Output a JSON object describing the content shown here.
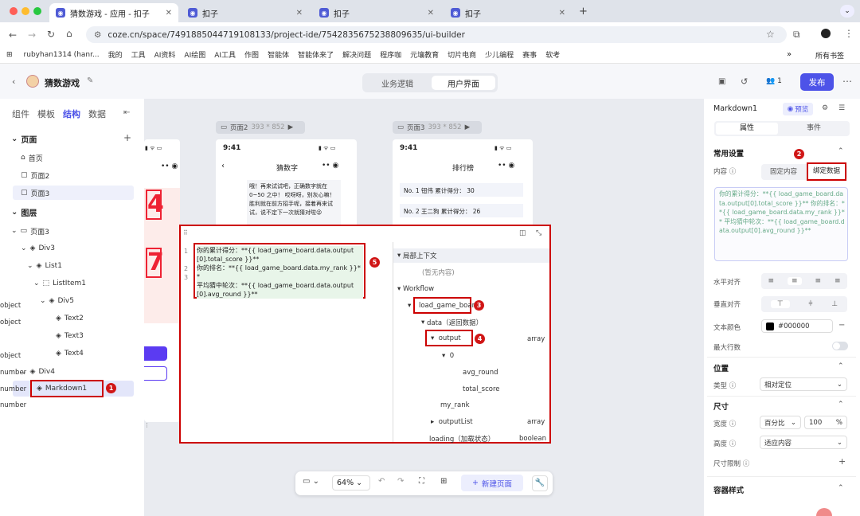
{
  "browser": {
    "tabs": [
      {
        "title": "猜数游戏 - 应用 - 扣子",
        "active": true
      },
      {
        "title": "扣子",
        "active": false
      },
      {
        "title": "扣子",
        "active": false
      },
      {
        "title": "扣子",
        "active": false
      }
    ],
    "url": "coze.cn/space/7491885044719108133/project-ide/7542835675238809635/ui-builder",
    "bookmarks": [
      "rubyhan1314 (hanr...",
      "我的",
      "工具",
      "AI资料",
      "AI绘图",
      "AI工具",
      "作图",
      "智能体",
      "智能体来了",
      "解决问题",
      "程序咖",
      "元壤教育",
      "切片电商",
      "少儿编程",
      "赛事",
      "软考"
    ],
    "bookmarks_more": "»",
    "bookmarks_all": "所有书签"
  },
  "app": {
    "title": "猜数游戏",
    "tabs": [
      "业务逻辑",
      "用户界面"
    ],
    "active_tab": "用户界面",
    "user_count": "1",
    "publish": "发布"
  },
  "left": {
    "tabs": [
      "组件",
      "模板",
      "结构",
      "数据"
    ],
    "active_tab": "结构",
    "pages_header": "页面",
    "pages": [
      "首页",
      "页面2",
      "页面3"
    ],
    "layers_header": "图层",
    "layers": [
      "页面3",
      "Div3",
      "List1",
      "ListItem1",
      "Div5",
      "Text2",
      "Text3",
      "Text4",
      "Div4",
      "Markdown1"
    ]
  },
  "canvas": {
    "page2_label": "页面2",
    "page2_size": "393 * 852",
    "page3_label": "页面3",
    "page3_size": "393 * 852",
    "time": "9:41",
    "page2_title": "猜数字",
    "page2_text": "哦！再来试试吧，正确数字就在0~50 之中！ 哎呀呀，别灰心嘛！胜利就在前方招手呢，接着再来试试，说不定下一次就猜对啦😜",
    "page3_title": "排行榜",
    "rank1": "No. 1 钮伟 累计得分： 30",
    "rank2": "No. 2 王二狗 累计得分： 26",
    "left_digits": [
      "4",
      "7"
    ],
    "zoom": "64%",
    "new_page": "新建页面"
  },
  "editor": {
    "lines": [
      {
        "n": "1",
        "text": "你的累计得分：**{{ load_game_board.data.output[0].total_score }}**"
      },
      {
        "n": "2",
        "text": "你的排名：**{{ load_game_board.data.my_rank }}**"
      },
      {
        "n": "3",
        "text": "平均猜中轮次：**{{ load_game_board.data.output[0].avg_round }}**"
      }
    ],
    "ctx_local": "局部上下文",
    "ctx_empty": "(暂无内容)",
    "workflow": "Workflow",
    "nodes": [
      {
        "name": "load_game_boar",
        "type": "object"
      },
      {
        "name": "data（返回数据）",
        "type": "object"
      },
      {
        "name": "output",
        "type": "array"
      },
      {
        "name": "0",
        "type": "object"
      },
      {
        "name": "avg_round",
        "type": "number"
      },
      {
        "name": "total_score",
        "type": "number"
      },
      {
        "name": "my_rank",
        "type": "number"
      },
      {
        "name": "outputList",
        "type": "array"
      },
      {
        "name": "loading（加载状态）",
        "type": "boolean"
      }
    ]
  },
  "right": {
    "component": "Markdown1",
    "preview": "预览",
    "tabs": [
      "属性",
      "事件"
    ],
    "common": "常用设置",
    "content_label": "内容",
    "fixed": "固定内容",
    "bind": "绑定数据",
    "content_text": "你的累计得分：**{{ load_game_board.data.output[0].total_score }}** 你的排名：**{{ load_game_board.data.my_rank }}** 平均猜中轮次：**{{ load_game_board.data.output[0].avg_round }}**",
    "h_align": "水平对齐",
    "v_align": "垂直对齐",
    "text_color": "文本颜色",
    "color_value": "#000000",
    "max_lines": "最大行数",
    "position": "位置",
    "type_label": "类型",
    "type_value": "相对定位",
    "size": "尺寸",
    "width_label": "宽度",
    "width_unit": "百分比",
    "width_value": "100",
    "width_pct": "%",
    "height_label": "高度",
    "height_value": "适应内容",
    "size_limit": "尺寸限制",
    "container": "容器样式"
  },
  "badges": [
    "1",
    "2",
    "3",
    "4",
    "5"
  ],
  "colors": {
    "accent": "#4d53e8",
    "annot": "#cc0000"
  }
}
